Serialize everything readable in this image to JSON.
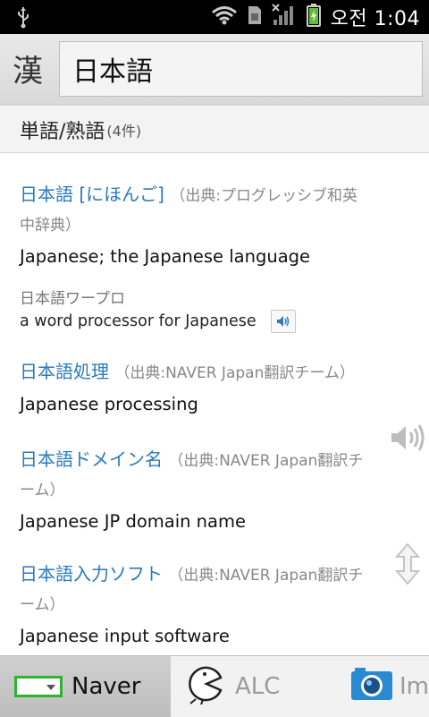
{
  "status_bar": {
    "time": "오전 1:04"
  },
  "header": {
    "kanji_button": "漢",
    "search_value": "日本語"
  },
  "section": {
    "title": "単語/熟語",
    "count": "(4件)"
  },
  "entries": [
    {
      "word": "日本語 [にほんご]",
      "source_line1": "（出典:プログレッシブ和英",
      "source_line2": "中辞典）",
      "meaning": "Japanese; the Japanese language",
      "example_jp": "日本語ワープロ",
      "example_en": "a word processor for Japanese"
    },
    {
      "word": "日本語処理",
      "source": "（出典:NAVER Japan翻訳チーム）",
      "meaning": "Japanese processing"
    },
    {
      "word": "日本語ドメイン名",
      "source_line1": "（出典:NAVER Japan翻訳チ",
      "source_line2": "ーム）",
      "meaning": "Japanese JP domain name"
    },
    {
      "word": "日本語入力ソフト",
      "source_line1": "（出典:NAVER Japan翻訳チ",
      "source_line2": "ーム）",
      "meaning": "Japanese input software"
    }
  ],
  "tabs": [
    {
      "label": "Naver",
      "active": true
    },
    {
      "label": "ALC",
      "active": false
    },
    {
      "label": "Ima",
      "active": false
    }
  ],
  "colors": {
    "link_blue": "#2a7bbd",
    "naver_green": "#2bb52b"
  }
}
